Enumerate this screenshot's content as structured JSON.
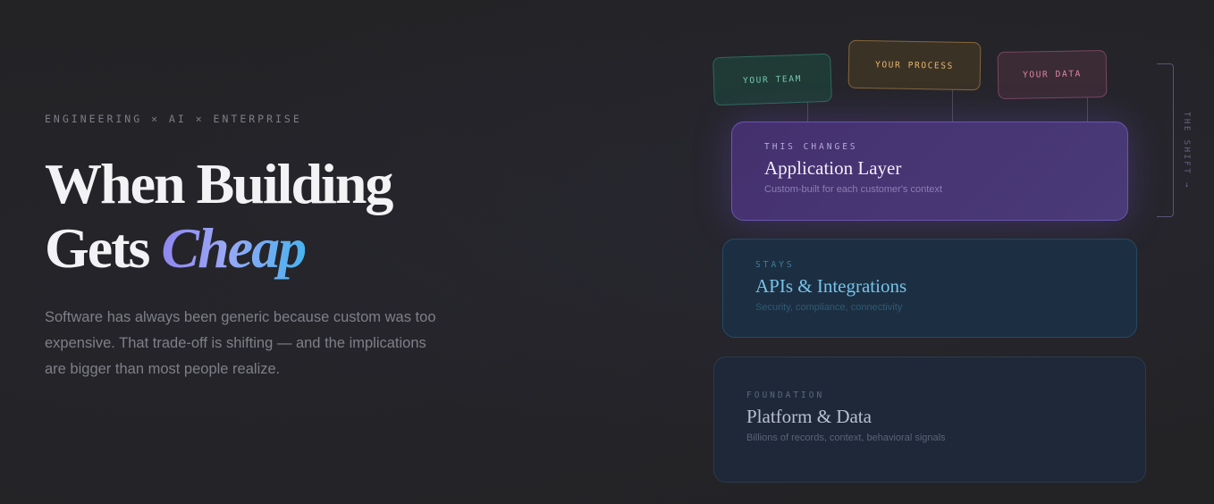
{
  "hero": {
    "eyebrow": "ENGINEERING × AI × ENTERPRISE",
    "title_line1": "When Building",
    "title_line2_prefix": "Gets ",
    "title_line2_accent": "Cheap",
    "lede": "Software has always been generic because custom was too expensive. That trade-off is shifting — and the implications are bigger than most people realize."
  },
  "diagram": {
    "chips": [
      "YOUR TEAM",
      "YOUR PROCESS",
      "YOUR DATA"
    ],
    "layers": [
      {
        "label": "THIS CHANGES",
        "heading": "Application Layer",
        "desc": "Custom-built for each customer's context"
      },
      {
        "label": "STAYS",
        "heading": "APIs & Integrations",
        "desc": "Security, compliance, connectivity"
      },
      {
        "label": "FOUNDATION",
        "heading": "Platform & Data",
        "desc": "Billions of records, context, behavioral signals"
      }
    ],
    "side_label": "THE SHIFT →"
  },
  "colors": {
    "accent_purple": "#8f86f0",
    "accent_blue": "#49b3ef",
    "team": "#73c9b0",
    "process": "#e7b86a",
    "data": "#e0879f"
  }
}
